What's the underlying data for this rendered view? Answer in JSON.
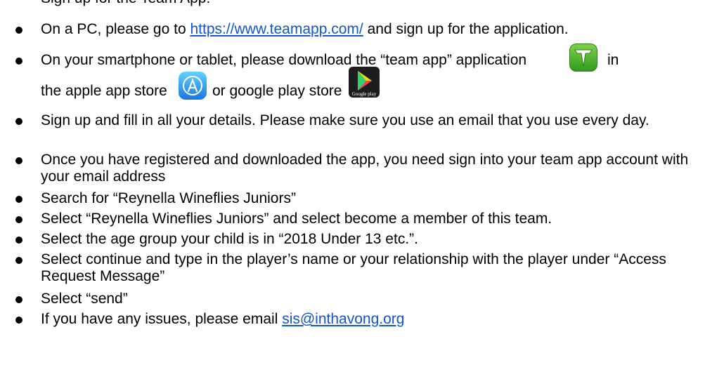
{
  "partial_top_text": "Sign up for the Team App:",
  "steps": [
    {
      "before": "On a PC, please go to ",
      "link": "https://www.teamapp.com/",
      "after": " and sign up for the application."
    },
    {
      "line1": "On your smartphone or tablet, please download the “team app” application",
      "line1_end": "in",
      "line2_a": "the apple app store",
      "line2_b": "or google play store",
      "google_play_caption": "Google play"
    },
    {
      "text": "Sign up and fill in all your details. Please make sure you use an email that you use every day."
    },
    {
      "text": "Once you have registered and downloaded the app, you need sign into your team app account with your email address"
    },
    {
      "text": "Search for “Reynella Wineflies Juniors”"
    },
    {
      "text": "Select “Reynella Wineflies Juniors” and select become a member of this team."
    },
    {
      "text": "Select the age group your child is in “2018 Under 13 etc.”."
    },
    {
      "text": "Select continue and type in the player’s name or your relationship with the player under “Access Request Message”"
    },
    {
      "text": "Select “send”"
    },
    {
      "before": "If you have any issues, please email ",
      "link": "sis@inthavong.org"
    }
  ],
  "icons": {
    "team_app": "team-app-icon",
    "apple_app_store": "apple-app-store-icon",
    "google_play": "google-play-store-icon"
  },
  "colors": {
    "link": "#1155cc",
    "team_app_green": "#4cb52e",
    "app_store_blue": "#1a8ef0"
  }
}
